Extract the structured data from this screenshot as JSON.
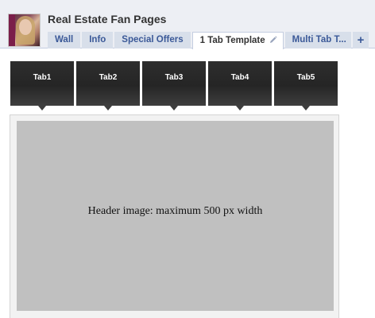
{
  "page": {
    "title": "Real Estate Fan Pages",
    "avatar_icon": "profile-photo-icon"
  },
  "tabs": [
    {
      "label": "Wall"
    },
    {
      "label": "Info"
    },
    {
      "label": "Special Offers"
    },
    {
      "label": "1 Tab Template",
      "active": true
    },
    {
      "label": "Multi Tab T..."
    },
    {
      "label": "+"
    }
  ],
  "nav_tabs": [
    {
      "label": "Tab1"
    },
    {
      "label": "Tab2"
    },
    {
      "label": "Tab3"
    },
    {
      "label": "Tab4"
    },
    {
      "label": "Tab5"
    }
  ],
  "header_image": {
    "caption": "Header image: maximum 500 px width"
  },
  "colors": {
    "brand": "#3b5998",
    "tab_bg": "#d8dfea",
    "bar_bg": "#edeff4",
    "nav_tab_bg": "#2e2e2e",
    "placeholder_bg": "#c0c0c0"
  }
}
